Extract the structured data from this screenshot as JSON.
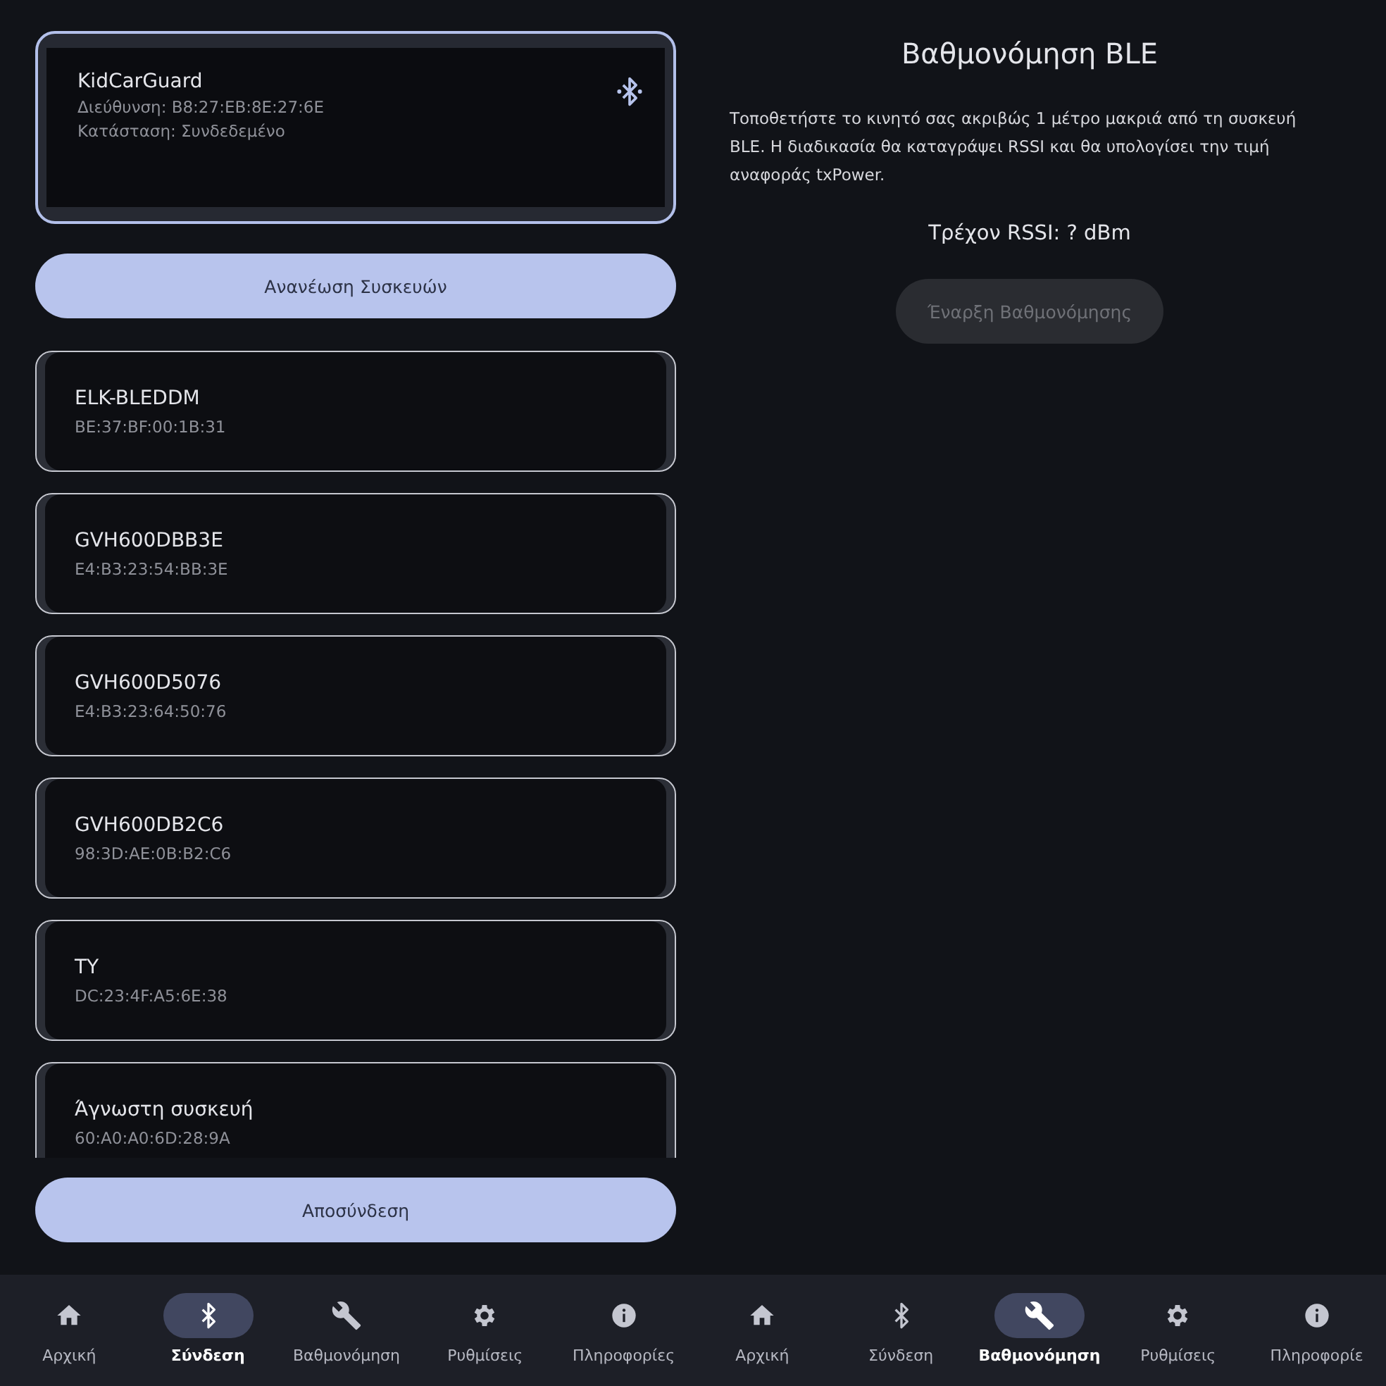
{
  "connected_device": {
    "name": "KidCarGuard",
    "address": "Διεύθυνση: B8:27:EB:8E:27:6E",
    "status": "Κατάσταση: Συνδεδεμένο"
  },
  "refresh_button": "Ανανέωση Συσκευών",
  "devices": [
    {
      "name": "ELK-BLEDDM",
      "address": "BE:37:BF:00:1B:31"
    },
    {
      "name": "GVH600DBB3E",
      "address": "E4:B3:23:54:BB:3E"
    },
    {
      "name": "GVH600D5076",
      "address": "E4:B3:23:64:50:76"
    },
    {
      "name": "GVH600DB2C6",
      "address": "98:3D:AE:0B:B2:C6"
    },
    {
      "name": "TY",
      "address": "DC:23:4F:A5:6E:38"
    },
    {
      "name": "Άγνωστη συσκευή",
      "address": "60:A0:A0:6D:28:9A"
    }
  ],
  "disconnect_button": "Αποσύνδεση",
  "calibration": {
    "title": "Βαθμονόμηση BLE",
    "instructions": "Τοποθετήστε το κινητό σας ακριβώς 1 μέτρο μακριά από τη συσκευή BLE. Η διαδικασία θα καταγράψει RSSI και θα υπολογίσει την τιμή αναφοράς txPower.",
    "rssi": "Τρέχον RSSI: ? dBm",
    "start_button": {
      "label": "Έναρξη Βαθμονόμησης",
      "disabled": true
    }
  },
  "nav_bars": [
    {
      "items": [
        {
          "label": "Αρχική",
          "selected": false
        },
        {
          "label": "Σύνδεση",
          "selected": true
        },
        {
          "label": "Βαθμονόμηση",
          "selected": false
        },
        {
          "label": "Ρυθμίσεις",
          "selected": false
        },
        {
          "label": "Πληροφορίες",
          "selected": false
        }
      ]
    },
    {
      "items": [
        {
          "label": "Αρχική",
          "selected": false
        },
        {
          "label": "Σύνδεση",
          "selected": false
        },
        {
          "label": "Βαθμονόμηση",
          "selected": true
        },
        {
          "label": "Ρυθμίσεις",
          "selected": false
        },
        {
          "label": "Πληροφορίε",
          "selected": false
        }
      ]
    }
  ]
}
